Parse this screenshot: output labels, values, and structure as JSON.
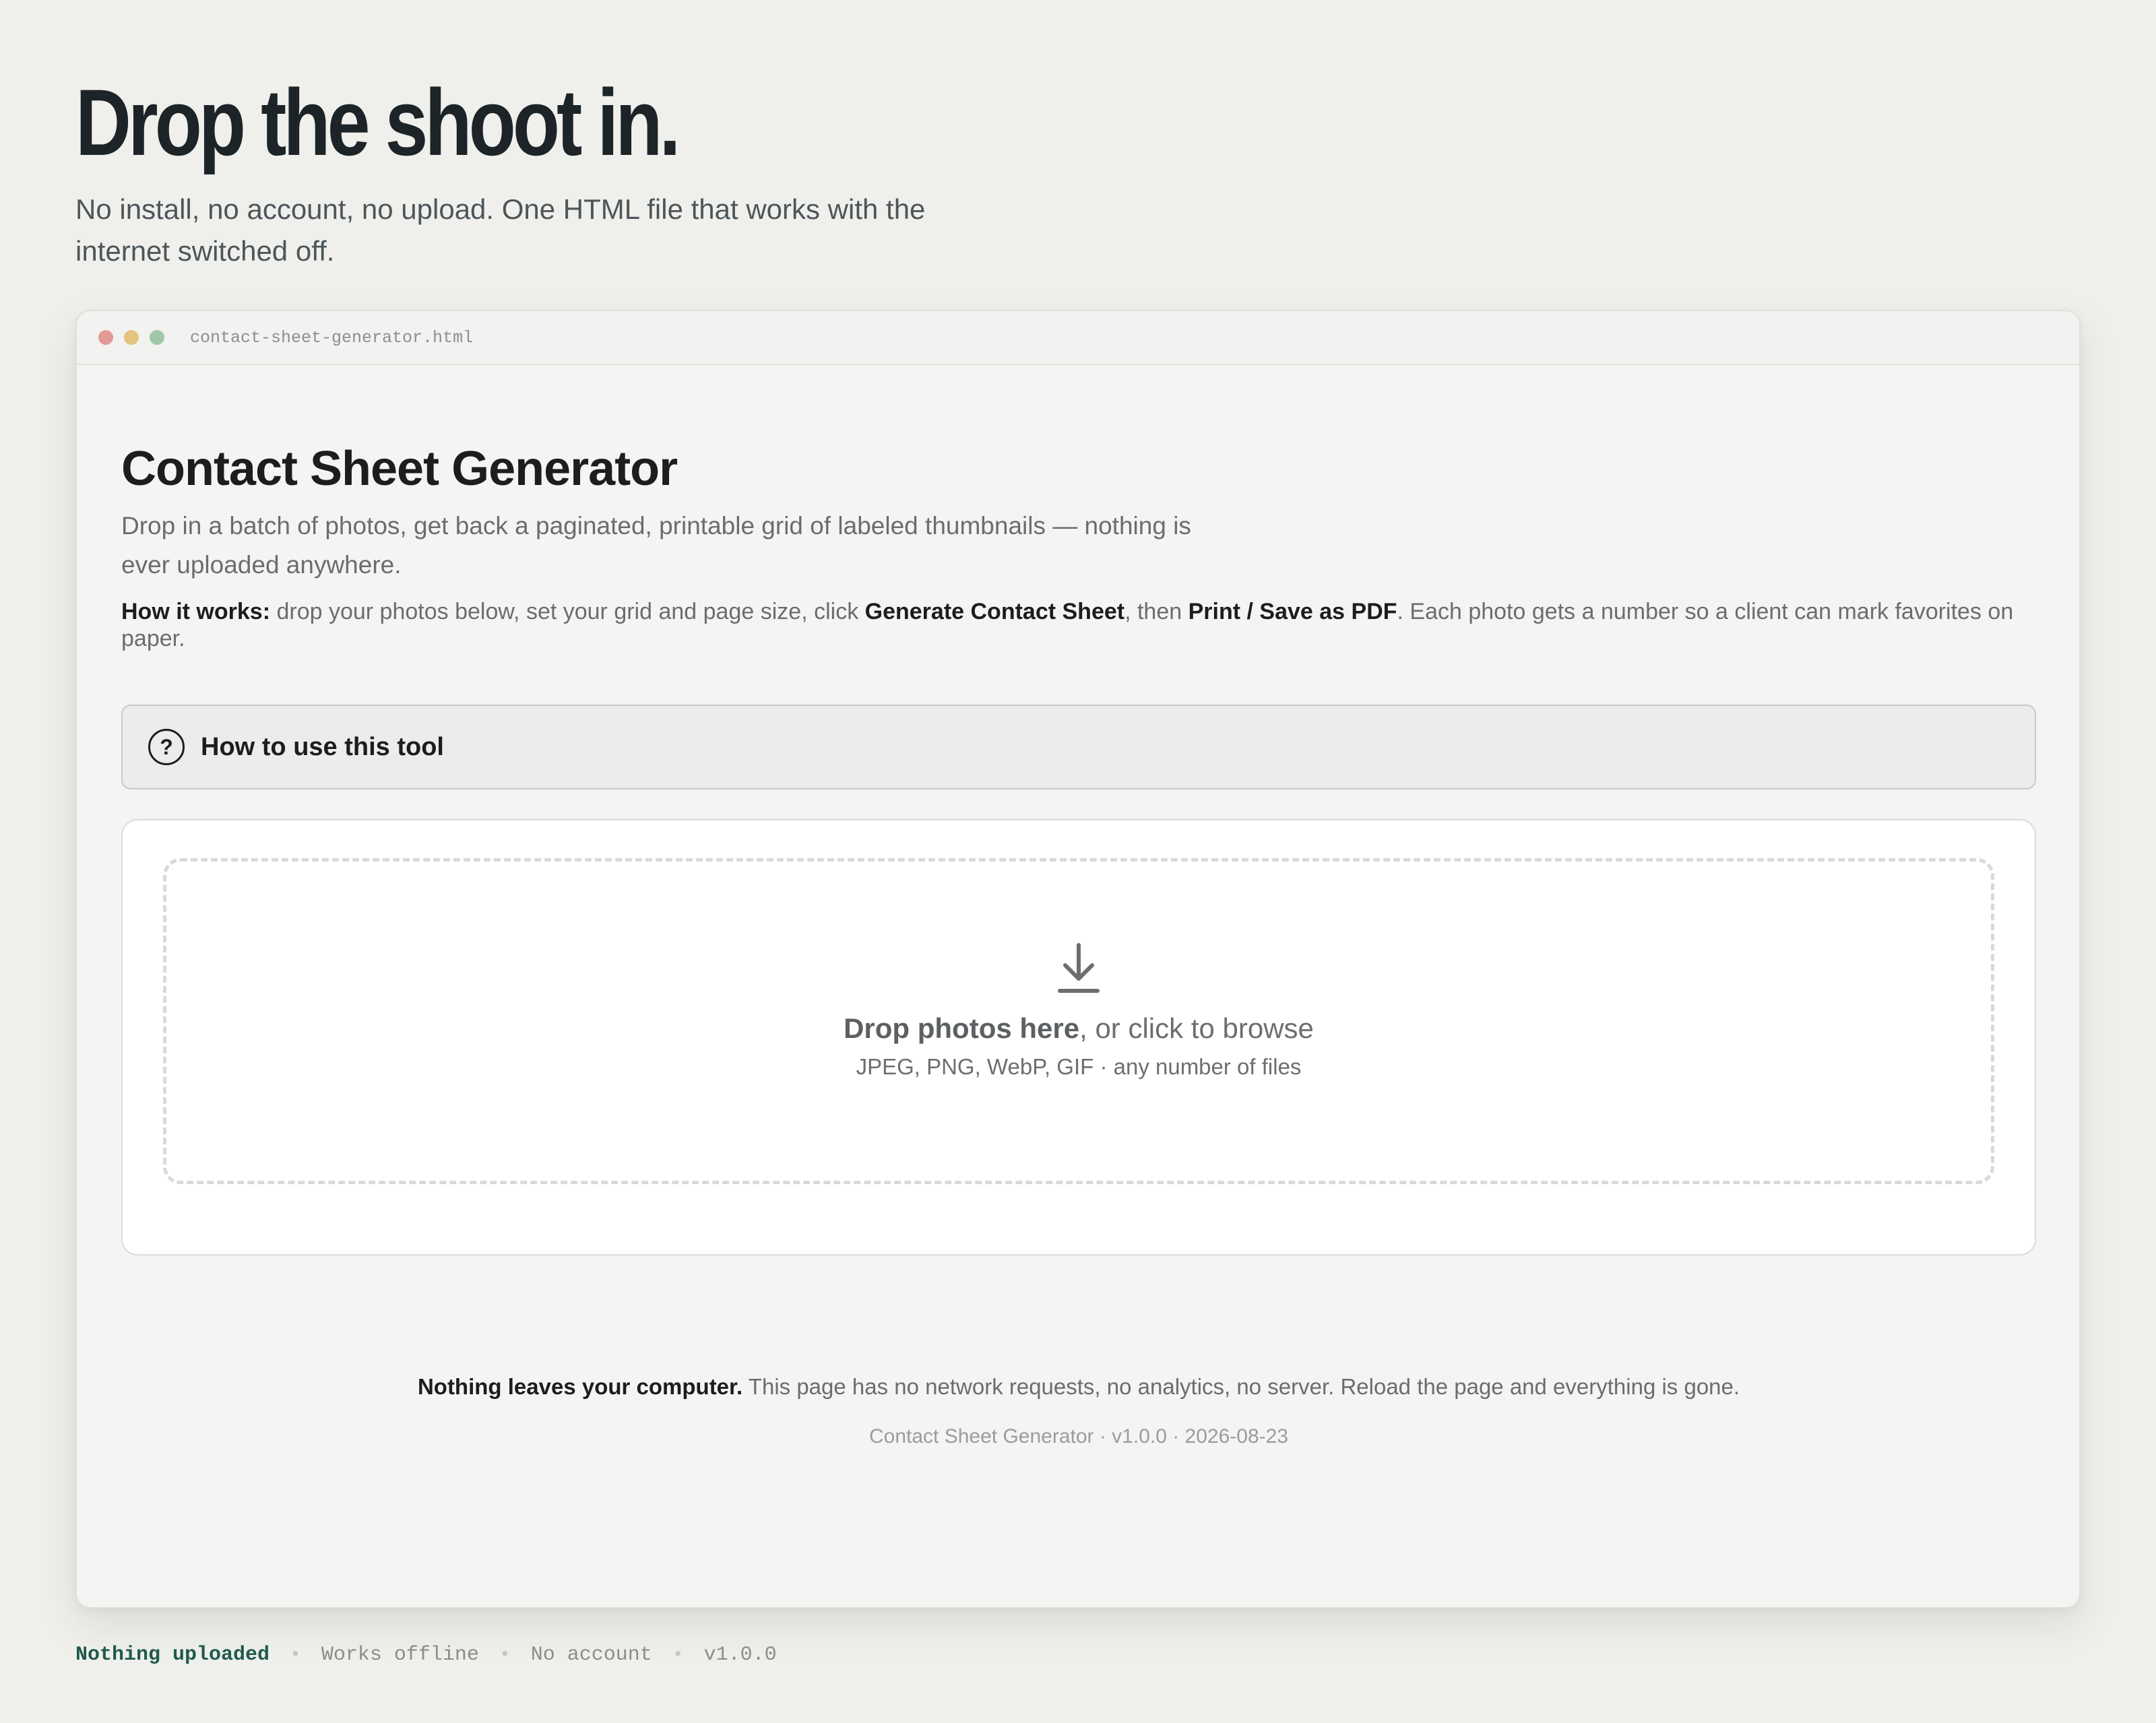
{
  "hero": {
    "title": "Drop the shoot in.",
    "subtitle": "No install, no account, no upload. One HTML file that works with the internet switched off."
  },
  "window": {
    "file_name": "contact-sheet-generator.html"
  },
  "app": {
    "title": "Contact Sheet Generator",
    "lead": "Drop in a batch of photos, get back a paginated, printable grid of labeled thumbnails — nothing is ever uploaded anywhere.",
    "how_it_works": {
      "label": "How it works:",
      "part1": " drop your photos below, set your grid and page size, click ",
      "generate_label": "Generate Contact Sheet",
      "part2": ", then ",
      "print_label": "Print / Save as PDF",
      "part3": ". Each photo gets a number so a client can mark favorites on paper."
    },
    "help_toggle": {
      "icon_glyph": "?",
      "label": "How to use this tool"
    },
    "drop_zone": {
      "icon": "download-arrow-icon",
      "main_bold": "Drop photos here",
      "main_rest": ", or click to browse",
      "sub": "JPEG, PNG, WebP, GIF · any number of files"
    },
    "privacy": {
      "bold": "Nothing leaves your computer.",
      "rest": " This page has no network requests, no analytics, no server. Reload the page and everything is gone."
    },
    "version_line": "Contact Sheet Generator · v1.0.0 · 2026-08-23"
  },
  "status_strip": {
    "items": [
      "Nothing uploaded",
      "Works offline",
      "No account",
      "v1.0.0"
    ],
    "separator": "•"
  },
  "colors": {
    "page_bg": "#eff0ec",
    "window_bg": "#f4f4f2",
    "accent_green": "#1f5a4c",
    "dot_red": "#e39a96",
    "dot_yellow": "#e3c37e",
    "dot_green": "#9fc8a8"
  }
}
